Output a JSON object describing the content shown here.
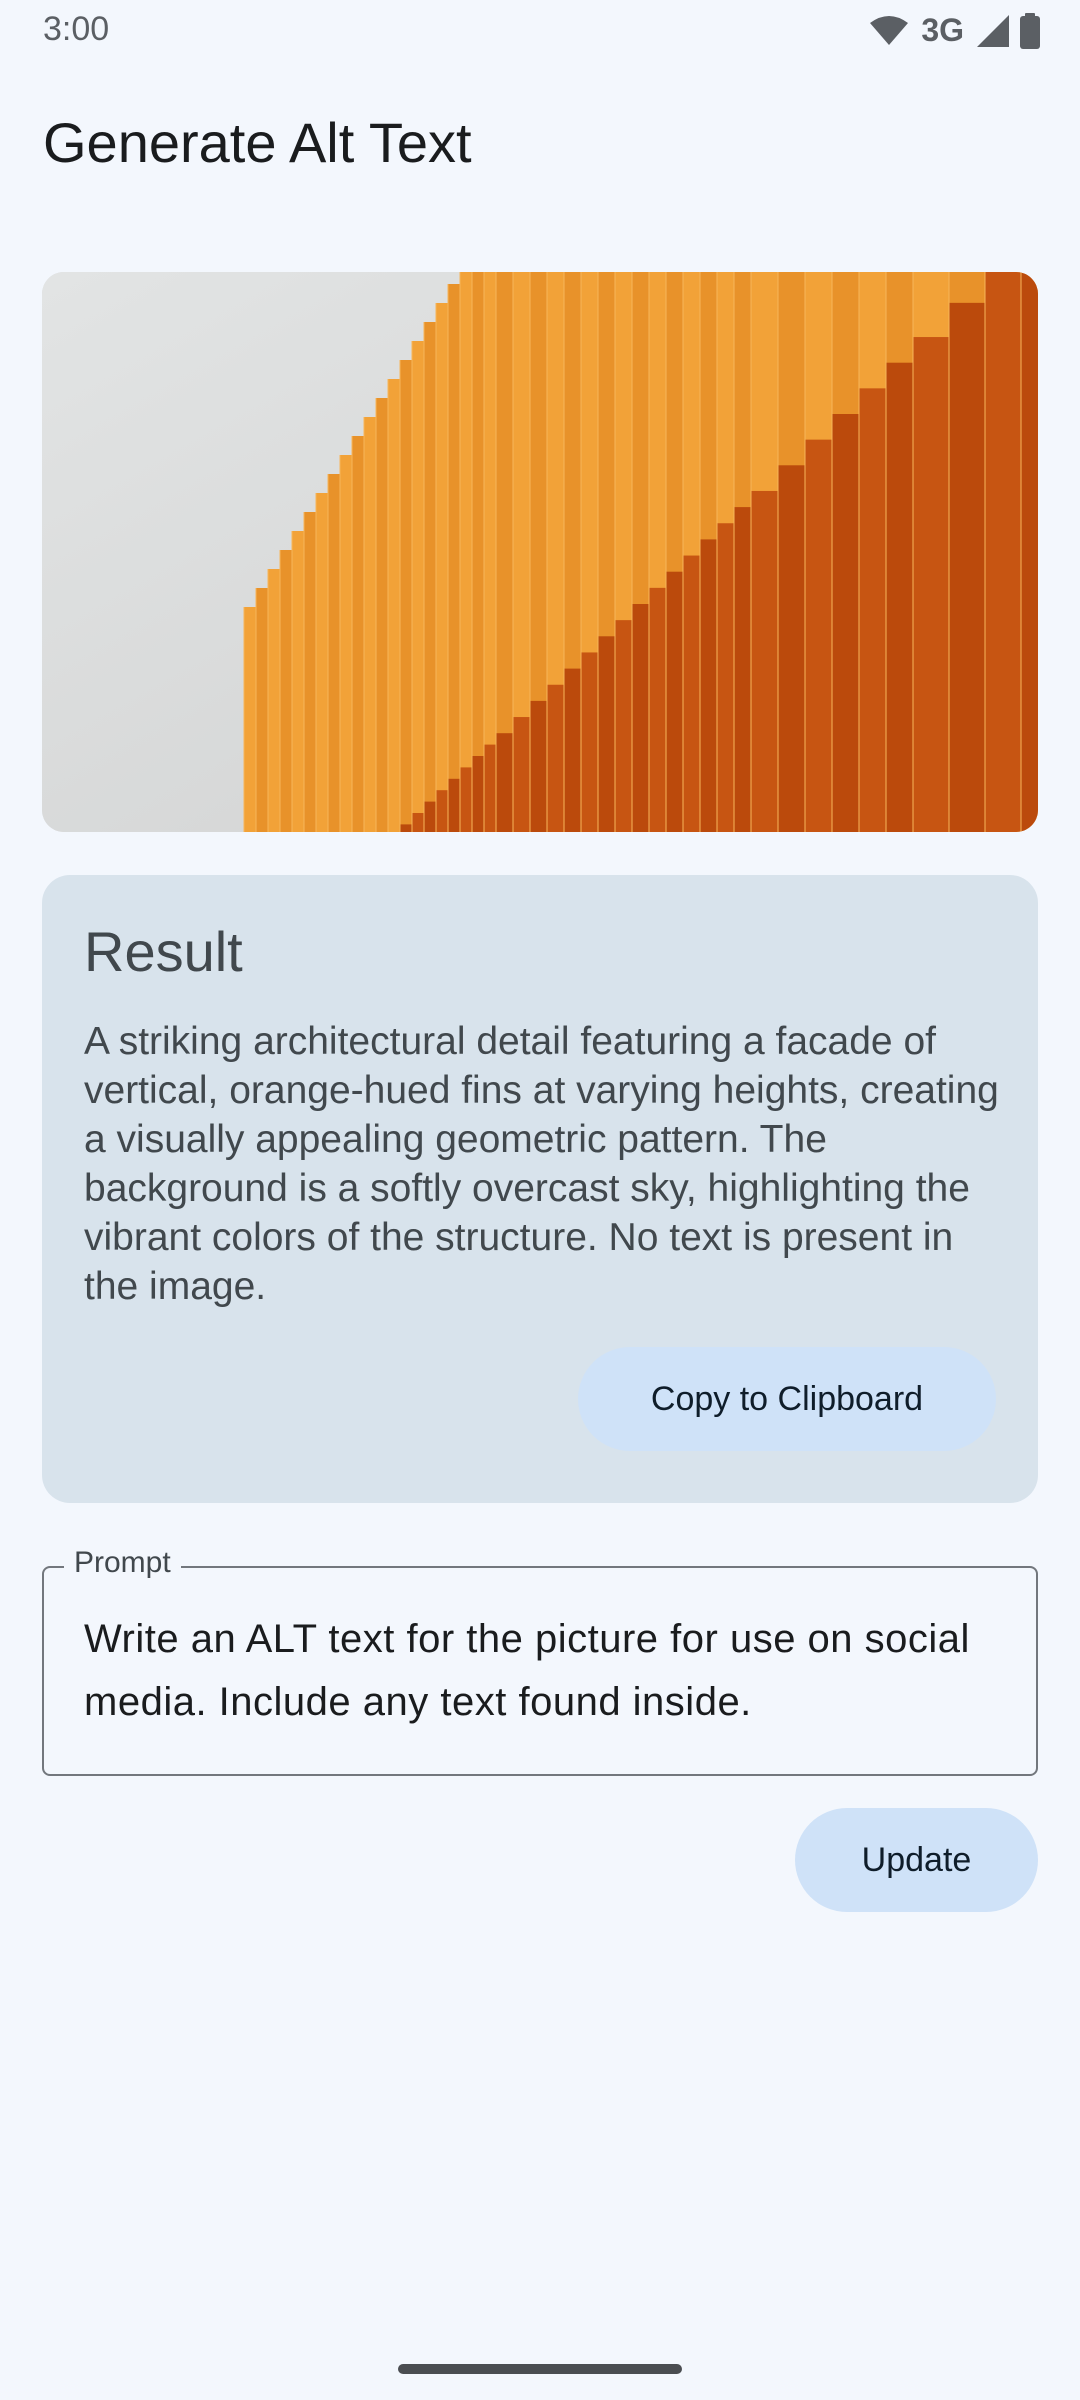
{
  "status_bar": {
    "time": "3:00",
    "network": "3G",
    "icons": [
      "wifi-icon",
      "signal-icon",
      "battery-icon"
    ]
  },
  "page": {
    "title": "Generate Alt Text"
  },
  "image": {
    "icon": "architectural-photo"
  },
  "result": {
    "heading": "Result",
    "text": "A striking architectural detail featuring a facade of vertical, orange-hued fins at varying heights, creating a visually appealing geometric pattern. The background is a softly overcast sky, highlighting the vibrant colors of the structure. No text is present in the image.",
    "copy_label": "Copy to Clipboard"
  },
  "prompt": {
    "label": "Prompt",
    "value": "Write an ALT text for the picture for use on social media. Include any text found inside."
  },
  "actions": {
    "update_label": "Update"
  },
  "colors": {
    "background": "#f3f7fd",
    "card": "#d8e3ec",
    "button": "#cfe2f8",
    "accent_orange": "#f09a2a",
    "deep_orange": "#c4500f"
  }
}
